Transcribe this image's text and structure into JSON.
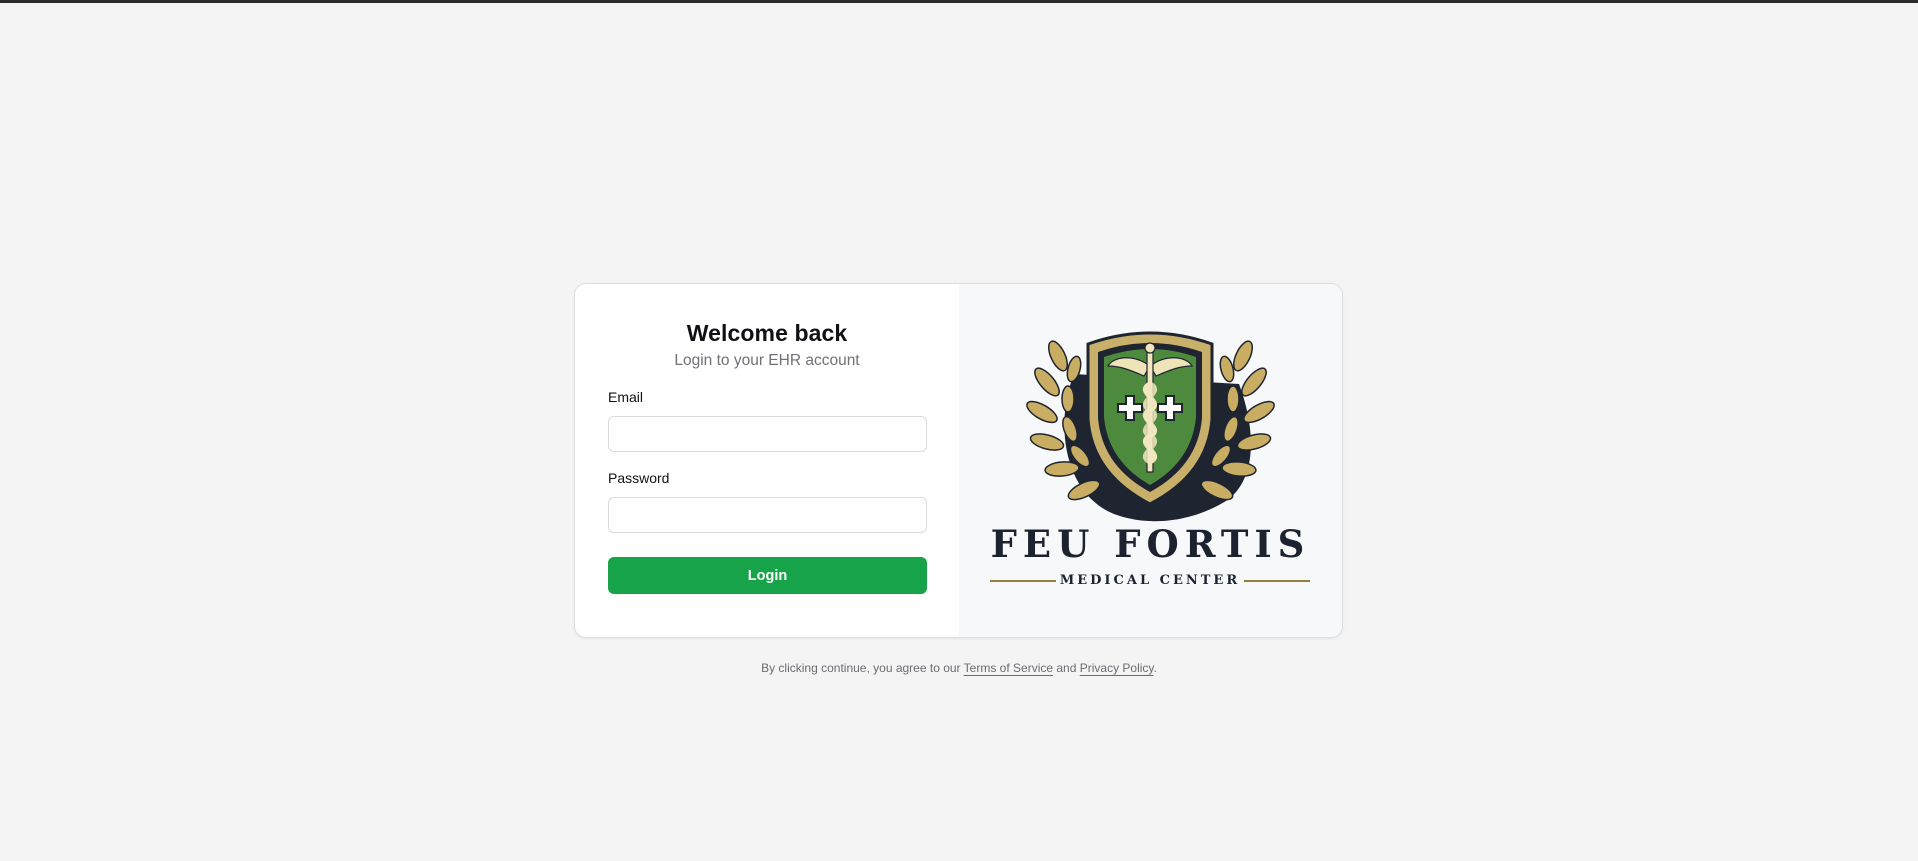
{
  "login": {
    "title": "Welcome back",
    "subtitle": "Login to your EHR account",
    "email_label": "Email",
    "email_value": "",
    "password_label": "Password",
    "password_value": "",
    "submit_label": "Login"
  },
  "brand": {
    "name": "FEU FORTIS",
    "tagline": "MEDICAL CENTER",
    "logo_icon": "caduceus-shield-laurel-icon"
  },
  "footer": {
    "prefix": "By clicking continue, you agree to our",
    "terms_link": "Terms of Service",
    "conjunction": "and",
    "privacy_link": "Privacy Policy",
    "suffix": "."
  },
  "colors": {
    "page_bg": "#f4f4f4",
    "accent_green": "#16a34a",
    "logo_gold": "#c9b06a",
    "logo_green": "#4e8a3e",
    "logo_navy": "#1c2230"
  }
}
